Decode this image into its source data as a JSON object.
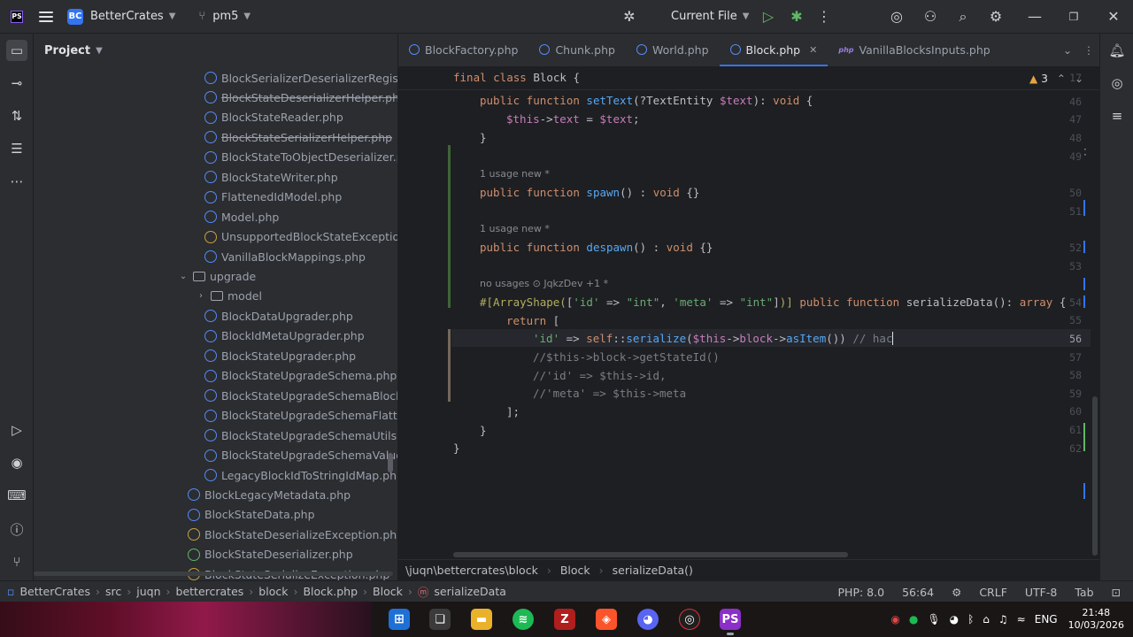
{
  "titlebar": {
    "app_logo": "PS",
    "project_badge": "BC",
    "project_name": "BetterCrates",
    "branch": "pm5",
    "run_config": "Current File"
  },
  "project_panel": {
    "title": "Project",
    "items": [
      {
        "label": "BlockSerializerDeserializerRegistra",
        "kind": "class",
        "strike": false
      },
      {
        "label": "BlockStateDeserializerHelper.php",
        "kind": "class",
        "strike": true
      },
      {
        "label": "BlockStateReader.php",
        "kind": "class",
        "strike": false
      },
      {
        "label": "BlockStateSerializerHelper.php",
        "kind": "class",
        "strike": true
      },
      {
        "label": "BlockStateToObjectDeserializer.ph",
        "kind": "class",
        "strike": false
      },
      {
        "label": "BlockStateWriter.php",
        "kind": "class",
        "strike": false
      },
      {
        "label": "FlattenedIdModel.php",
        "kind": "class",
        "strike": false
      },
      {
        "label": "Model.php",
        "kind": "class",
        "strike": false
      },
      {
        "label": "UnsupportedBlockStateException",
        "kind": "exception",
        "strike": false
      },
      {
        "label": "VanillaBlockMappings.php",
        "kind": "class",
        "strike": false
      },
      {
        "label": "upgrade",
        "kind": "folder-open",
        "strike": false
      },
      {
        "label": "model",
        "kind": "folder-closed",
        "strike": false
      },
      {
        "label": "BlockDataUpgrader.php",
        "kind": "class",
        "strike": false
      },
      {
        "label": "BlockIdMetaUpgrader.php",
        "kind": "class",
        "strike": false
      },
      {
        "label": "BlockStateUpgrader.php",
        "kind": "class",
        "strike": false
      },
      {
        "label": "BlockStateUpgradeSchema.php",
        "kind": "class",
        "strike": false
      },
      {
        "label": "BlockStateUpgradeSchemaBlockRe",
        "kind": "class",
        "strike": false
      },
      {
        "label": "BlockStateUpgradeSchemaFlatten",
        "kind": "class",
        "strike": false
      },
      {
        "label": "BlockStateUpgradeSchemaUtils.pl",
        "kind": "class",
        "strike": false
      },
      {
        "label": "BlockStateUpgradeSchemaValueR",
        "kind": "class",
        "strike": false
      },
      {
        "label": "LegacyBlockIdToStringIdMap.php",
        "kind": "class",
        "strike": false
      },
      {
        "label": "BlockLegacyMetadata.php",
        "kind": "class",
        "strike": false
      },
      {
        "label": "BlockStateData.php",
        "kind": "class",
        "strike": false
      },
      {
        "label": "BlockStateDeserializeException.php",
        "kind": "exception",
        "strike": false
      },
      {
        "label": "BlockStateDeserializer.php",
        "kind": "trait",
        "strike": false
      },
      {
        "label": "BlockStateSerializeException.php",
        "kind": "exception",
        "strike": true
      }
    ]
  },
  "tabs": [
    {
      "label": "BlockFactory.php",
      "active": false
    },
    {
      "label": "Chunk.php",
      "active": false
    },
    {
      "label": "World.php",
      "active": false
    },
    {
      "label": "Block.php",
      "active": true
    },
    {
      "label": "VanillaBlocksInputs.php",
      "active": false
    }
  ],
  "editor": {
    "sticky_line_number": "17",
    "sticky_header": "final class Block {",
    "warnings_count": "3",
    "line_numbers": [
      "46",
      "47",
      "48",
      "49",
      "50",
      "51",
      "52",
      "53",
      "54",
      "55",
      "56",
      "57",
      "58",
      "59",
      "60",
      "61",
      "62"
    ],
    "hints": {
      "spawn_usage": "1 usage   new *",
      "despawn_usage": "1 usage   new *",
      "serialize_usage": "no usages   ⊙ JqkzDev +1 *"
    },
    "code": {
      "l46": "public function setText(?TextEntity $text): void {",
      "l47": "$this->text = $text;",
      "l48": "}",
      "l50": "public function spawn() : void {}",
      "l52": "public function despawn() : void {}",
      "l54": "#[ArrayShape(['id' => \"int\", 'meta' => \"int\"])] public function serializeData(): array {",
      "l55": "return [",
      "l56": "'id' => self::serialize($this->block->asItem()) // hac",
      "l57": "//$this->block->getStateId()",
      "l58": "//'id' => $this->id,",
      "l59": "//'meta' => $this->meta",
      "l60": "];",
      "l61": "}",
      "l62": "}"
    },
    "breadcrumbs": [
      "\\juqn\\bettercrates\\block",
      "Block",
      "serializeData()"
    ]
  },
  "statusbar": {
    "path": [
      "BetterCrates",
      "src",
      "juqn",
      "bettercrates",
      "block",
      "Block.php",
      "Block",
      "serializeData"
    ],
    "php_version": "PHP: 8.0",
    "position": "56:64",
    "line_sep": "CRLF",
    "encoding": "UTF-8",
    "indent": "Tab"
  },
  "taskbar": {
    "lang": "ENG",
    "time": "21:48",
    "date": "10/03/2026"
  },
  "colors": {
    "accent": "#3574f0",
    "background": "#1e1f22",
    "panel": "#2b2d30"
  }
}
